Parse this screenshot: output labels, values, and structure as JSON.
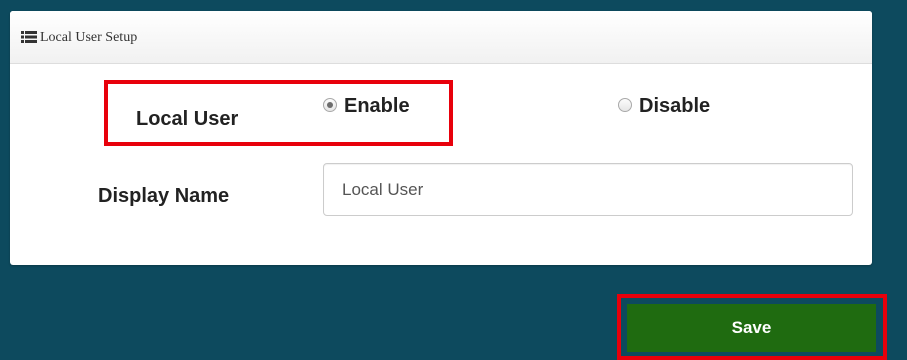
{
  "panel": {
    "title": "Local User Setup",
    "header_icon": "list-icon"
  },
  "form": {
    "local_user": {
      "label": "Local User",
      "options": [
        {
          "label": "Enable",
          "selected": true
        },
        {
          "label": "Disable",
          "selected": false
        }
      ]
    },
    "display_name": {
      "label": "Display Name",
      "value": "Local User"
    }
  },
  "actions": {
    "save_label": "Save"
  },
  "colors": {
    "background": "#0d4a5e",
    "highlight_border": "#e8000b",
    "save_button": "#1f6b10"
  }
}
